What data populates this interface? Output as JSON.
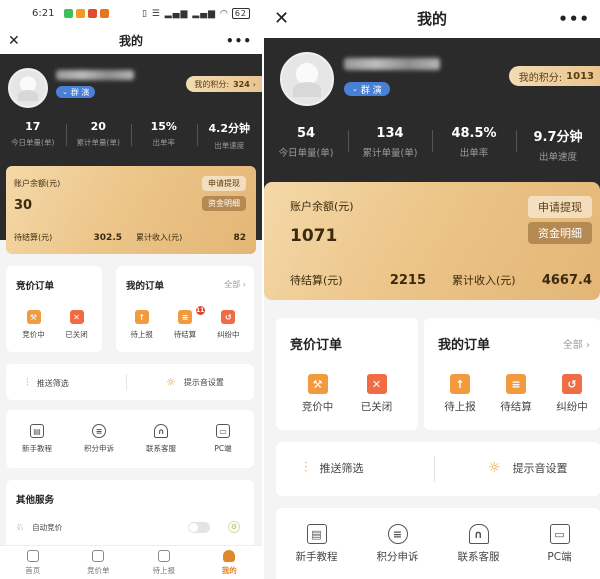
{
  "status": {
    "time": "6:21",
    "battery": "62"
  },
  "title": "我的",
  "profile": {
    "group_badge": "群 演"
  },
  "points": {
    "label": "我的积分:",
    "left_value": "324",
    "right_value": "1013"
  },
  "left_stats": [
    {
      "value": "17",
      "label": "今日单量(单)"
    },
    {
      "value": "20",
      "label": "累计单量(单)"
    },
    {
      "value": "15%",
      "label": "出单率"
    },
    {
      "value": "4.2分钟",
      "label": "出单速度"
    }
  ],
  "right_stats": [
    {
      "value": "54",
      "label": "今日单量(单)"
    },
    {
      "value": "134",
      "label": "累计单量(单)"
    },
    {
      "value": "48.5%",
      "label": "出单率"
    },
    {
      "value": "9.7分钟",
      "label": "出单速度"
    }
  ],
  "account": {
    "title": "账户余额(元)",
    "withdraw": "申请提现",
    "details": "资金明细",
    "pending_label": "待结算(元)",
    "total_label": "累计收入(元)",
    "left": {
      "balance": "30",
      "pending": "302.5",
      "total": "82"
    },
    "right": {
      "balance": "1071",
      "pending": "2215",
      "total": "4667.4"
    }
  },
  "bidding": {
    "title": "竞价订单",
    "items": [
      "竞价中",
      "已关闭"
    ]
  },
  "my_orders": {
    "title": "我的订单",
    "all": "全部",
    "items": [
      "待上报",
      "待结算",
      "纠纷中"
    ],
    "pending_count": "11"
  },
  "filters": {
    "push": "推送筛选",
    "sound": "提示音设置"
  },
  "tools": [
    "新手教程",
    "积分申诉",
    "联系客服",
    "PC端"
  ],
  "other": {
    "title": "其他服务",
    "auto_bid": "自动竞价"
  },
  "nav": [
    "首页",
    "竞价单",
    "待上报",
    "我的"
  ]
}
